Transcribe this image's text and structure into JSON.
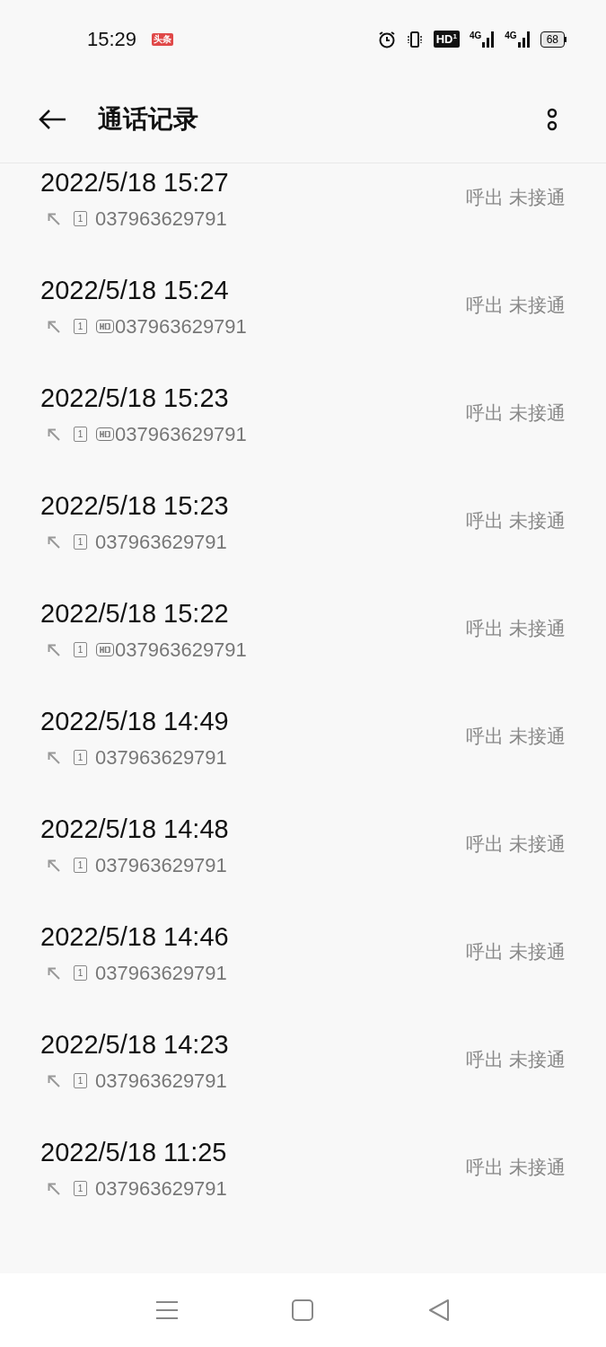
{
  "status_bar": {
    "time": "15:29",
    "app_badge": "头条",
    "hd_label": "HD",
    "hd_sub": "1",
    "network_1": "4G",
    "network_2": "4G",
    "battery": "68"
  },
  "header": {
    "title": "通话记录"
  },
  "calls": [
    {
      "date": "2022/5/18 15:27",
      "sim": "1",
      "hd": false,
      "number": "037963629791",
      "status": "呼出 未接通"
    },
    {
      "date": "2022/5/18 15:24",
      "sim": "1",
      "hd": true,
      "number": "037963629791",
      "status": "呼出 未接通"
    },
    {
      "date": "2022/5/18 15:23",
      "sim": "1",
      "hd": true,
      "number": "037963629791",
      "status": "呼出 未接通"
    },
    {
      "date": "2022/5/18 15:23",
      "sim": "1",
      "hd": false,
      "number": "037963629791",
      "status": "呼出 未接通"
    },
    {
      "date": "2022/5/18 15:22",
      "sim": "1",
      "hd": true,
      "number": "037963629791",
      "status": "呼出 未接通"
    },
    {
      "date": "2022/5/18 14:49",
      "sim": "1",
      "hd": false,
      "number": "037963629791",
      "status": "呼出 未接通"
    },
    {
      "date": "2022/5/18 14:48",
      "sim": "1",
      "hd": false,
      "number": "037963629791",
      "status": "呼出 未接通"
    },
    {
      "date": "2022/5/18 14:46",
      "sim": "1",
      "hd": false,
      "number": "037963629791",
      "status": "呼出 未接通"
    },
    {
      "date": "2022/5/18 14:23",
      "sim": "1",
      "hd": false,
      "number": "037963629791",
      "status": "呼出 未接通"
    },
    {
      "date": "2022/5/18 11:25",
      "sim": "1",
      "hd": false,
      "number": "037963629791",
      "status": "呼出 未接通"
    }
  ]
}
